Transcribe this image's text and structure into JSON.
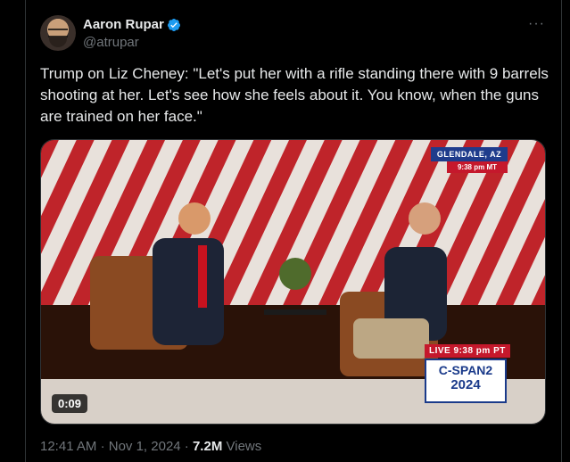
{
  "author": {
    "name": "Aaron Rupar",
    "handle": "@atrupar",
    "verified_color": "#1d9bf0"
  },
  "menu": {
    "more_label": "···"
  },
  "tweet": {
    "text": "Trump on Liz Cheney: \"Let's put her with a rifle standing there with 9 barrels shooting at her. Let's see how she feels about it. You know, when the guns are trained on her face.\""
  },
  "video": {
    "duration": "0:09",
    "location_badge": "GLENDALE, AZ",
    "location_time": "9:38 pm MT",
    "live_label": "LIVE  9:38 pm PT",
    "network_name": "C-SPAN2",
    "network_year": "2024"
  },
  "meta": {
    "time": "12:41 AM",
    "separator": "·",
    "date": "Nov 1, 2024",
    "views_count": "7.2M",
    "views_label": "Views"
  },
  "colors": {
    "background": "#000000",
    "text": "#e7e9ea",
    "muted": "#71767b",
    "border": "#2f3336"
  }
}
